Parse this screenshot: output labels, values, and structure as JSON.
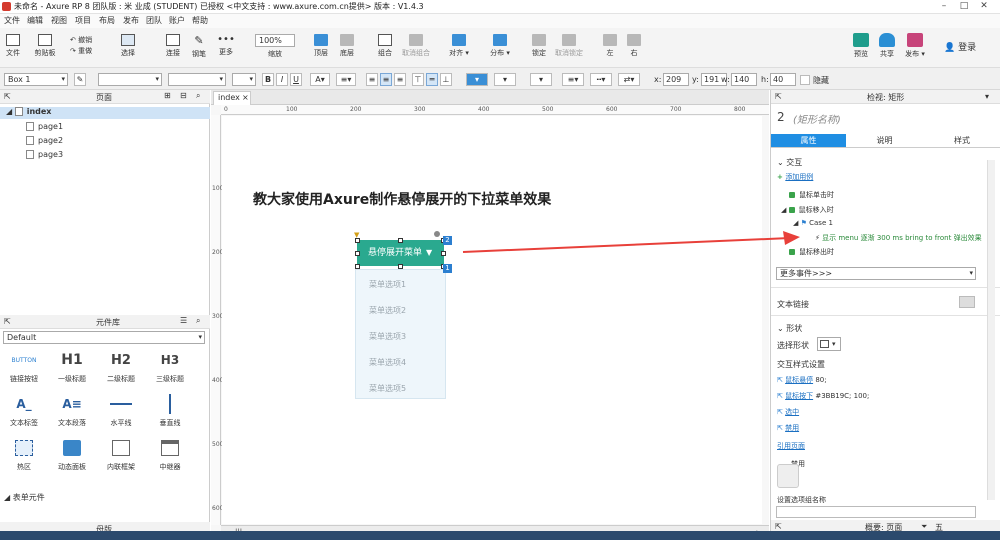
{
  "window": {
    "title": "未命名 - Axure RP 8 团队版 : 米 业成 (STUDENT) 已授权   <中文支持 : www.axure.com.cn提供> 版本 : V1.4.3"
  },
  "menu": [
    "文件",
    "编辑",
    "视图",
    "项目",
    "布局",
    "发布",
    "团队",
    "账户",
    "帮助"
  ],
  "toolbar": {
    "file": "文件",
    "clipboard": "剪贴板",
    "undo": "撤销",
    "redo": "重做",
    "select": "选择",
    "connect": "连接",
    "pen": "钢笔",
    "more": "更多",
    "zoom_value": "100%",
    "zoom_label": "缩放",
    "top": "顶层",
    "bottom": "底层",
    "group": "组合",
    "ungroup": "取消组合",
    "align": "对齐",
    "distribute": "分布",
    "lock": "锁定",
    "unlock": "取消锁定",
    "left": "左",
    "right": "右",
    "preview": "预览",
    "share": "共享",
    "publish": "发布",
    "login": "登录"
  },
  "formatbar": {
    "style_name": "Box 1",
    "x_label": "x:",
    "x": "209",
    "y_label": "y:",
    "y": "191",
    "w_label": "w:",
    "w": "140",
    "h_label": "h:",
    "h": "40",
    "hide_label": "隐藏"
  },
  "pages": {
    "header": "页面",
    "items": [
      "index",
      "page1",
      "page2",
      "page3"
    ]
  },
  "library": {
    "header": "元件库",
    "selected": "Default",
    "items": [
      {
        "glyph": "BUTTON",
        "label": "链接按钮"
      },
      {
        "glyph": "H1",
        "label": "一级标题"
      },
      {
        "glyph": "H2",
        "label": "二级标题"
      },
      {
        "glyph": "H3",
        "label": "三级标题"
      },
      {
        "glyph": "A_",
        "label": "文本标签"
      },
      {
        "glyph": "A≡",
        "label": "文本段落"
      },
      {
        "glyph": "",
        "label": "水平线"
      },
      {
        "glyph": "",
        "label": "垂直线"
      },
      {
        "glyph": "",
        "label": "热区"
      },
      {
        "glyph": "",
        "label": "动态面板"
      },
      {
        "glyph": "",
        "label": "内联框架"
      },
      {
        "glyph": "",
        "label": "中继器"
      }
    ],
    "form_section": "表单元件",
    "masters_header": "母版"
  },
  "canvas": {
    "tab": "index",
    "heading": "教大家使用Axure制作悬停展开的下拉菜单效果",
    "menu_button": "悬停展开菜单",
    "badge_2": "2",
    "badge_1": "1",
    "menu_items": [
      "菜单选项1",
      "菜单选项2",
      "菜单选项3",
      "菜单选项4",
      "菜单选项5"
    ],
    "ruler_h": [
      "0",
      "100",
      "200",
      "300",
      "400",
      "500",
      "600",
      "700",
      "800"
    ],
    "ruler_v": [
      "100",
      "200",
      "300",
      "400",
      "500",
      "600"
    ]
  },
  "inspector": {
    "header": "检视: 矩形",
    "widget_number": "2",
    "widget_name": "(矩形名称)",
    "tabs": [
      "属性",
      "说明",
      "样式"
    ],
    "interaction": "交互",
    "add_case": "添加用例",
    "events": [
      "鼠标单击时",
      "鼠标移入时"
    ],
    "case": "Case 1",
    "action": "显示 menu 逐渐 300 ms bring to front 弹出效果",
    "event_out": "鼠标移出时",
    "more_events": "更多事件>>>",
    "text_link": "文本链接",
    "shape": "形状",
    "select_shape": "选择形状",
    "interaction_styles": "交互样式设置",
    "hover": "鼠标悬停",
    "hover_value": "80;",
    "mousedown": "鼠标按下",
    "mousedown_value": "#3BB19C; 100;",
    "selected": "选中",
    "disabled": "禁用",
    "ref_page": "引用页面",
    "disabled2": "禁用",
    "selected_group": "设置选项组名称",
    "footer": "概要: 页面"
  },
  "colors": {
    "accent": "#2aa98f",
    "arrow": "#e8403a",
    "tab_active": "#1f8ee3"
  }
}
